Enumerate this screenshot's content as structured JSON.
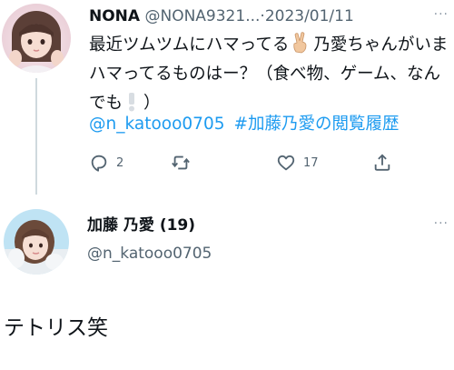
{
  "tweet": {
    "display_name": "NONA",
    "handle": "@NONA9321...",
    "separator": "·",
    "date": "2023/01/11",
    "more_label": "···",
    "text_part1": "最近ツムツムにハマってる",
    "text_part2": "乃愛ちゃんがいまハマってるものはー？（食べ物、ゲーム、なんでも",
    "text_part3": "）",
    "mention": "@n_katooo0705",
    "hashtag": "#加藤乃愛の閲覧履歴",
    "reply_count": "2",
    "like_count": "17",
    "icons": [
      "reply-icon",
      "retweet-icon",
      "like-icon",
      "share-icon"
    ]
  },
  "reply": {
    "display_name": "加藤 乃愛 (19)",
    "handle": "@n_katooo0705",
    "more_label": "···",
    "text": "テトリス笑"
  },
  "colors": {
    "link": "#1d9bf0",
    "secondary_text": "#536471",
    "thread_line": "#cfd9de"
  }
}
